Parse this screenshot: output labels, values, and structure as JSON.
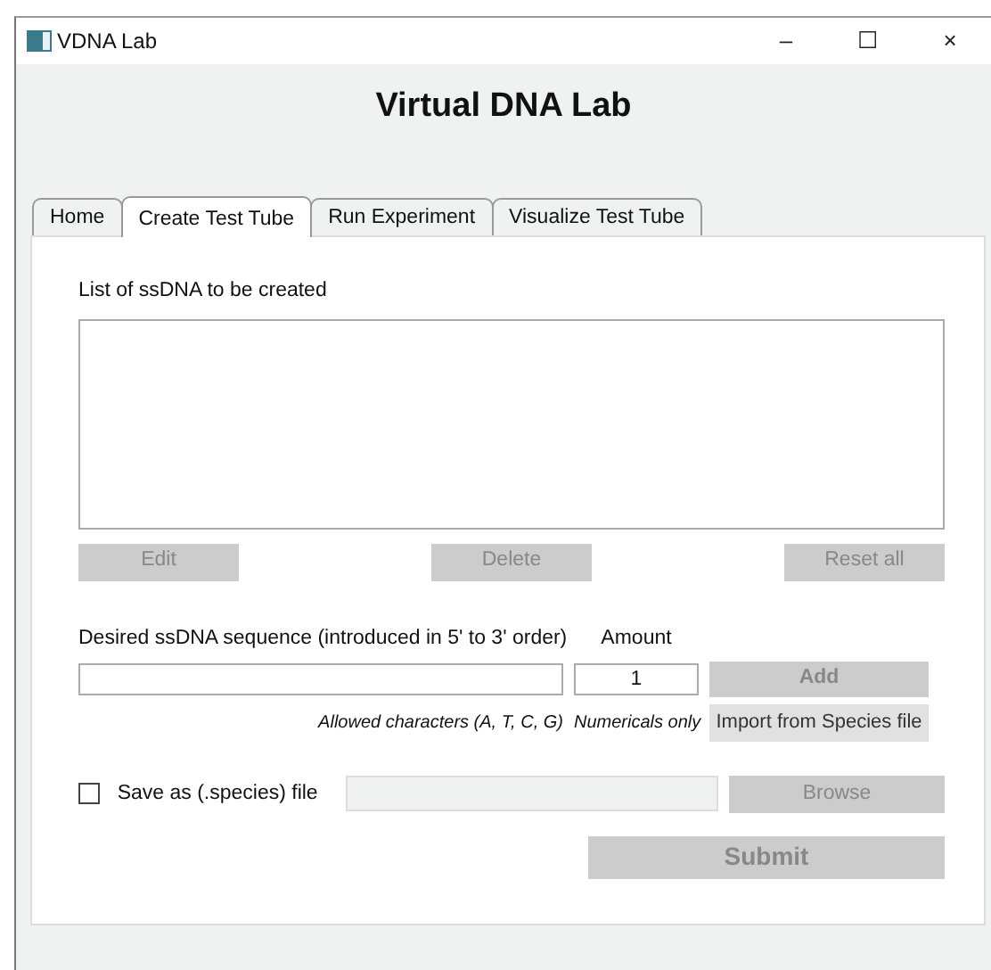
{
  "window": {
    "title": "VDNA Lab",
    "controls": [
      "–",
      "☐",
      "×"
    ]
  },
  "heading": "Virtual DNA Lab",
  "tabs": [
    {
      "label": "Home",
      "selected": false
    },
    {
      "label": "Create Test Tube",
      "selected": true
    },
    {
      "label": "Run Experiment",
      "selected": false
    },
    {
      "label": "Visualize Test Tube",
      "selected": false
    }
  ],
  "list": {
    "label": "List of ssDNA to be created"
  },
  "list_buttons": [
    {
      "label": "Edit",
      "disabled": true
    },
    {
      "label": "Delete",
      "disabled": true
    },
    {
      "label": "Reset all",
      "disabled": true
    }
  ],
  "sequence": {
    "label": "Desired ssDNA sequence (introduced in 5' to 3' order)",
    "hint": "Allowed characters (A, T, C, G)"
  },
  "amount": {
    "label": "Amount",
    "value": "1",
    "hint": "Numericals only"
  },
  "add_button": {
    "label": "Add",
    "disabled": true
  },
  "import_button": {
    "label": "Import from Species file",
    "disabled": false
  },
  "save": {
    "label": "Save as (.species) file",
    "checked": false,
    "path_disabled": true
  },
  "browse_button": {
    "label": "Browse",
    "disabled": true
  },
  "submit_button": {
    "label": "Submit",
    "disabled": true
  }
}
